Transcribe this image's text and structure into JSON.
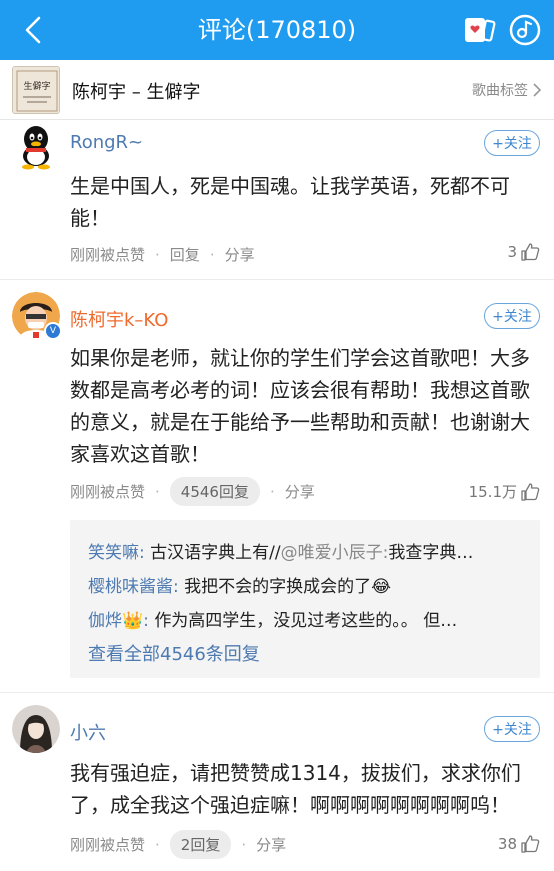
{
  "header": {
    "title": "评论(170810)",
    "bg_color": "#1f9cf0"
  },
  "song": {
    "title": "陈柯宇 – 生僻字",
    "tag_label": "歌曲标签",
    "thumb_text": "生僻字"
  },
  "comments": [
    {
      "user": "RongR~",
      "follow_label": "+关注",
      "text": "生是中国人，死是中国魂。让我学英语，死都不可能！",
      "time": "刚刚被点赞",
      "reply_label": "回复",
      "share_label": "分享",
      "likes": "3"
    },
    {
      "user": "陈柯宇k–KO",
      "follow_label": "+关注",
      "text": "如果你是老师，就让你的学生们学会这首歌吧！大多数都是高考必考的词！应该会很有帮助！我想这首歌的意义，就是在于能给予一些帮助和贡献！也谢谢大家喜欢这首歌！",
      "time": "刚刚被点赞",
      "reply_label": "4546回复",
      "share_label": "分享",
      "likes": "15.1万",
      "replies": [
        {
          "name": "笑笑嘛:",
          "text": "古汉语字典上有//",
          "at": "@唯爱小辰子:",
          "text2": "我查字典…"
        },
        {
          "name": "樱桃味酱酱:",
          "text": "我把不会的字换成会的了😂",
          "at": "",
          "text2": ""
        },
        {
          "name": "伽烨👑:",
          "text": "作为高四学生，没见过考这些的。。 但…",
          "at": "",
          "text2": ""
        }
      ],
      "view_all": "查看全部4546条回复"
    },
    {
      "user": "小六",
      "follow_label": "+关注",
      "text": "我有强迫症，请把赞赞成1314，拔拔们，求求你们了，成全我这个强迫症嘛！啊啊啊啊啊啊啊啊呜！",
      "time": "刚刚被点赞",
      "reply_label": "2回复",
      "share_label": "分享",
      "likes": "38"
    }
  ]
}
